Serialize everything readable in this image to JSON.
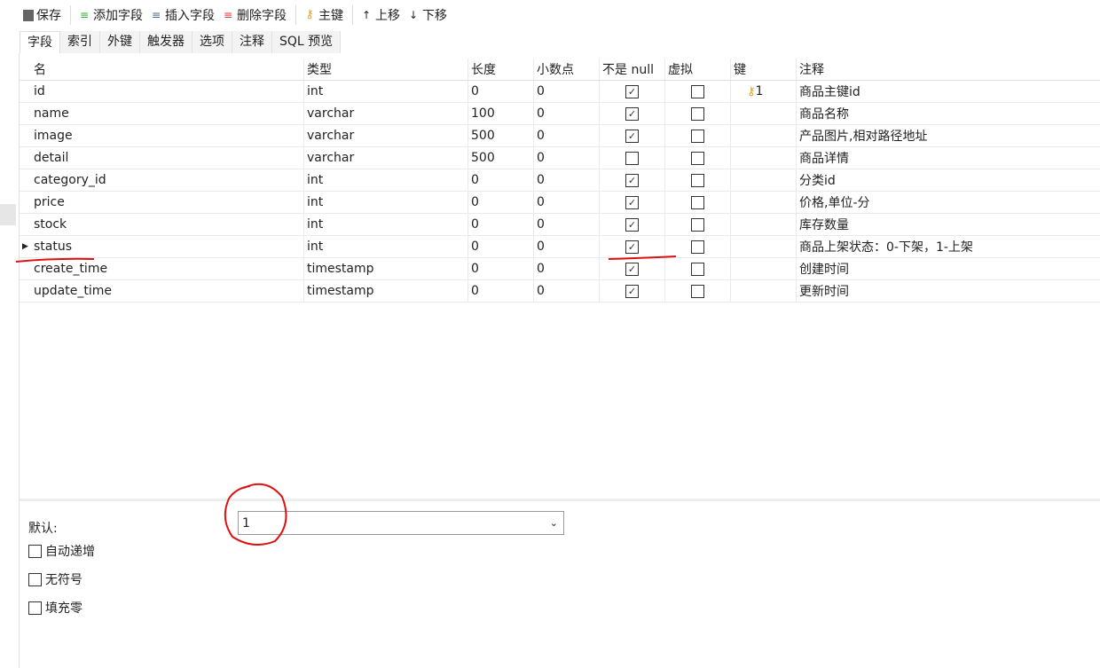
{
  "toolbar": {
    "save": "保存",
    "add_field": "添加字段",
    "insert_field": "插入字段",
    "delete_field": "删除字段",
    "primary_key": "主键",
    "move_up": "上移",
    "move_down": "下移"
  },
  "tabs": [
    "字段",
    "索引",
    "外键",
    "触发器",
    "选项",
    "注释",
    "SQL 预览"
  ],
  "columns": [
    "名",
    "类型",
    "长度",
    "小数点",
    "不是 null",
    "虚拟",
    "键",
    "注释"
  ],
  "rows": [
    {
      "name": "id",
      "type": "int",
      "length": "0",
      "decimals": "0",
      "not_null": true,
      "virtual": false,
      "key": "1",
      "comment": "商品主键id"
    },
    {
      "name": "name",
      "type": "varchar",
      "length": "100",
      "decimals": "0",
      "not_null": true,
      "virtual": false,
      "key": "",
      "comment": "商品名称"
    },
    {
      "name": "image",
      "type": "varchar",
      "length": "500",
      "decimals": "0",
      "not_null": true,
      "virtual": false,
      "key": "",
      "comment": "产品图片,相对路径地址"
    },
    {
      "name": "detail",
      "type": "varchar",
      "length": "500",
      "decimals": "0",
      "not_null": false,
      "virtual": false,
      "key": "",
      "comment": "商品详情"
    },
    {
      "name": "category_id",
      "type": "int",
      "length": "0",
      "decimals": "0",
      "not_null": true,
      "virtual": false,
      "key": "",
      "comment": "分类id"
    },
    {
      "name": "price",
      "type": "int",
      "length": "0",
      "decimals": "0",
      "not_null": true,
      "virtual": false,
      "key": "",
      "comment": "价格,单位-分"
    },
    {
      "name": "stock",
      "type": "int",
      "length": "0",
      "decimals": "0",
      "not_null": true,
      "virtual": false,
      "key": "",
      "comment": "库存数量"
    },
    {
      "name": "status",
      "type": "int",
      "length": "0",
      "decimals": "0",
      "not_null": true,
      "virtual": false,
      "key": "",
      "comment": "商品上架状态：0-下架，1-上架"
    },
    {
      "name": "create_time",
      "type": "timestamp",
      "length": "0",
      "decimals": "0",
      "not_null": true,
      "virtual": false,
      "key": "",
      "comment": "创建时间"
    },
    {
      "name": "update_time",
      "type": "timestamp",
      "length": "0",
      "decimals": "0",
      "not_null": true,
      "virtual": false,
      "key": "",
      "comment": "更新时间"
    }
  ],
  "selected_row": 7,
  "props": {
    "default_label": "默认:",
    "default_value": "1",
    "auto_increment": "自动递增",
    "unsigned": "无符号",
    "zerofill": "填充零"
  },
  "annotation_color": "#e01010"
}
